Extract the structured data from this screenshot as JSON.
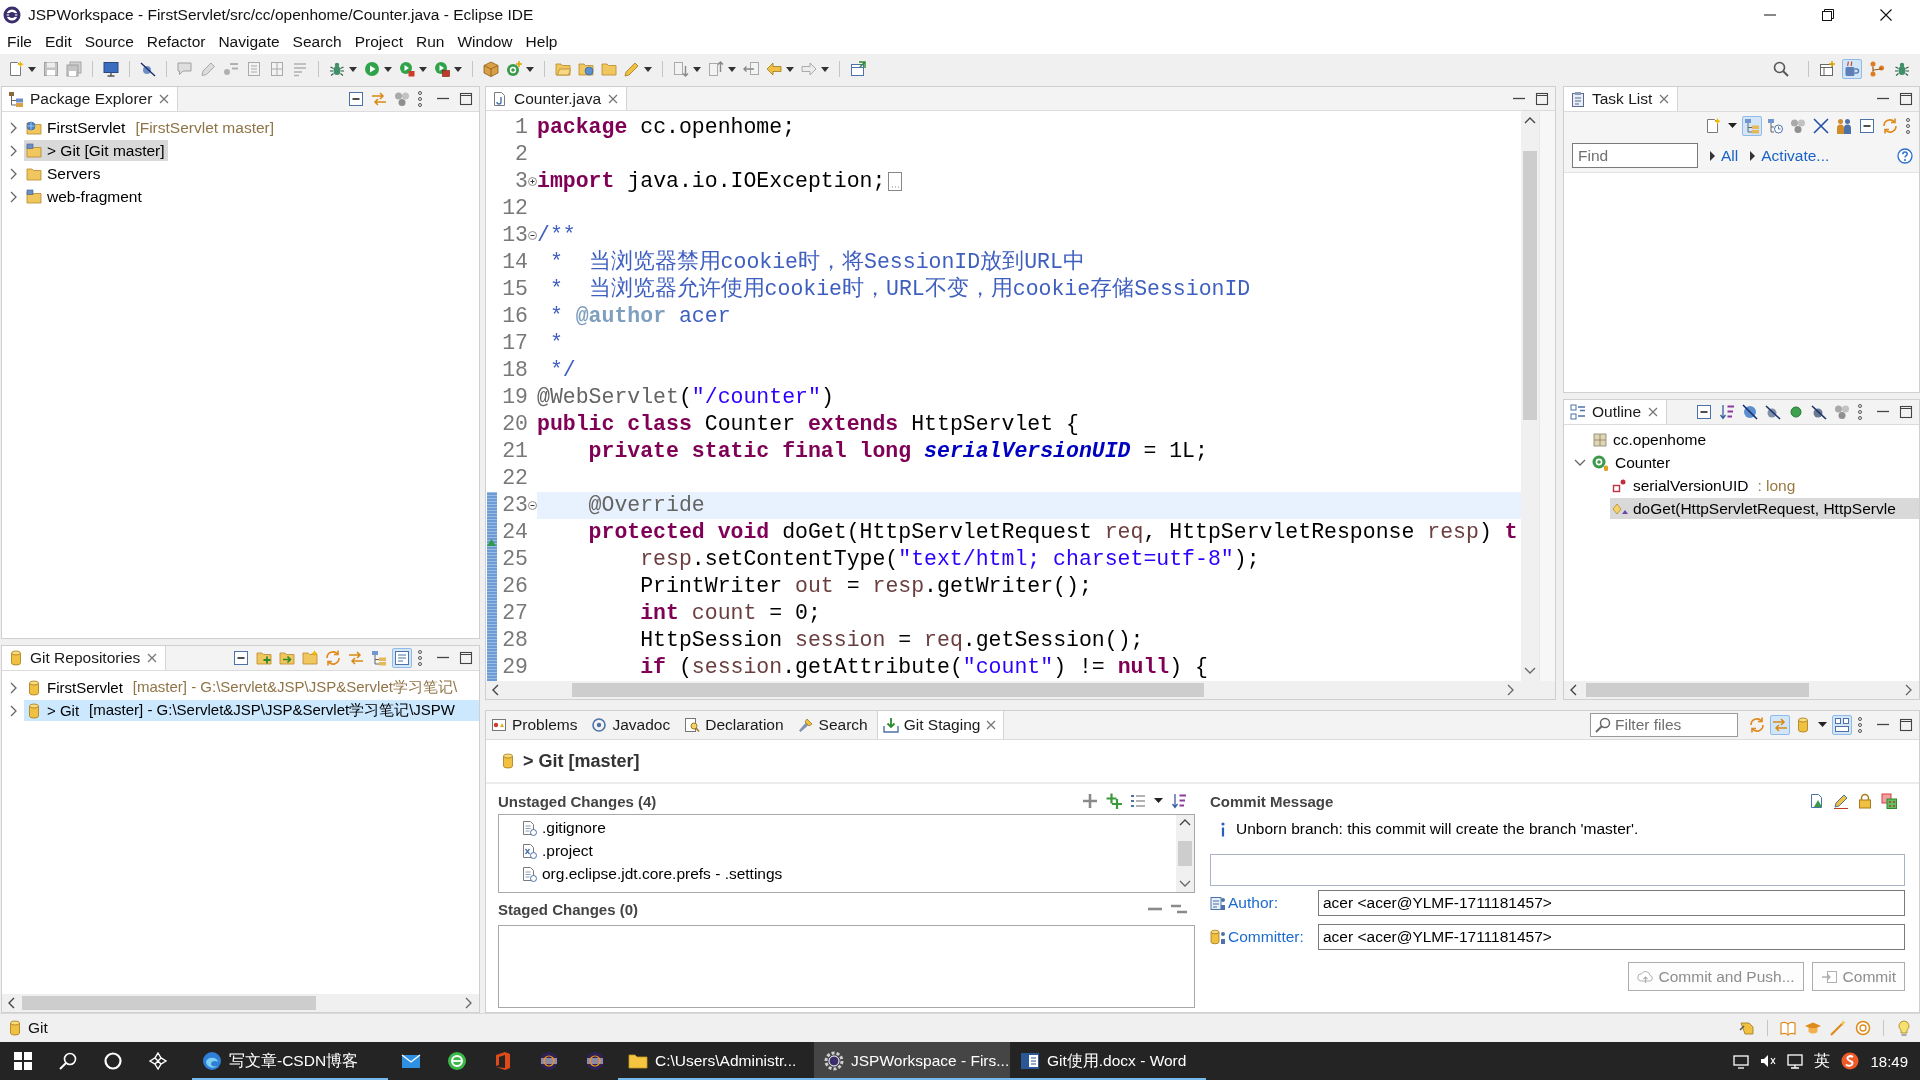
{
  "window": {
    "title": "JSPWorkspace - FirstServlet/src/cc/openhome/Counter.java - Eclipse IDE"
  },
  "menu": [
    "File",
    "Edit",
    "Source",
    "Refactor",
    "Navigate",
    "Search",
    "Project",
    "Run",
    "Window",
    "Help"
  ],
  "perspectives": [
    {
      "kind": "open",
      "selected": false
    },
    {
      "kind": "java",
      "selected": true
    },
    {
      "kind": "git",
      "selected": false
    },
    {
      "kind": "debug",
      "selected": false
    }
  ],
  "package_explorer": {
    "title": "Package Explorer",
    "toolbar": [
      {
        "kind": "collapse-all",
        "selected": false
      },
      {
        "kind": "link-editor",
        "selected": false
      },
      {
        "kind": "filters",
        "selected": false
      },
      {
        "kind": "view-menu",
        "selected": false
      }
    ],
    "items": [
      {
        "kind": "web-project",
        "label": "FirstServlet",
        "decoration": "[FirstServlet master]",
        "expanded": false,
        "selected": false
      },
      {
        "kind": "project",
        "label": "> Git [Git master]",
        "expanded": false,
        "selected": true
      },
      {
        "kind": "folder",
        "label": "Servers",
        "expanded": false,
        "selected": false
      },
      {
        "kind": "project",
        "label": "web-fragment",
        "expanded": false,
        "selected": false
      }
    ]
  },
  "editor": {
    "tab": "Counter.java",
    "lines": [
      {
        "number": "1",
        "changed": false,
        "current": false,
        "tokens": [
          {
            "kind": "keyword",
            "text": "package"
          },
          {
            "kind": "plain",
            "text": " cc.openhome;"
          }
        ]
      },
      {
        "number": "2",
        "changed": false,
        "current": false
      },
      {
        "number": "3",
        "changed": false,
        "current": false,
        "fold": {
          "expanded": false
        },
        "tokens": [
          {
            "kind": "keyword",
            "text": "import"
          },
          {
            "kind": "plain",
            "text": " java.io.IOException;"
          }
        ]
      },
      {
        "number": "12",
        "changed": false,
        "current": false
      },
      {
        "number": "13",
        "changed": false,
        "current": false,
        "fold": {
          "expanded": true
        },
        "tokens": [
          {
            "kind": "javadoc",
            "text": "/**"
          }
        ]
      },
      {
        "number": "14",
        "changed": false,
        "current": false,
        "tokens": [
          {
            "kind": "javadoc",
            "text": " *  当浏览器禁用cookie时，将SessionID放到URL中"
          }
        ]
      },
      {
        "number": "15",
        "changed": false,
        "current": false,
        "tokens": [
          {
            "kind": "javadoc",
            "text": " *  当浏览器允许使用cookie时，URL不变，用cookie存储SessionID"
          }
        ]
      },
      {
        "number": "16",
        "changed": false,
        "current": false,
        "tokens": [
          {
            "kind": "javadoc",
            "text": " * "
          },
          {
            "kind": "javadoc-tag",
            "text": "@author"
          },
          {
            "kind": "javadoc",
            "text": " acer"
          }
        ]
      },
      {
        "number": "17",
        "changed": false,
        "current": false,
        "tokens": [
          {
            "kind": "javadoc",
            "text": " *"
          }
        ]
      },
      {
        "number": "18",
        "changed": false,
        "current": false,
        "tokens": [
          {
            "kind": "javadoc",
            "text": " */"
          }
        ]
      },
      {
        "number": "19",
        "changed": false,
        "current": false,
        "tokens": [
          {
            "kind": "annotation",
            "text": "@WebServlet"
          },
          {
            "kind": "plain",
            "text": "("
          },
          {
            "kind": "string",
            "text": "\"/counter\""
          },
          {
            "kind": "plain",
            "text": ")"
          }
        ]
      },
      {
        "number": "20",
        "changed": false,
        "current": false,
        "tokens": [
          {
            "kind": "keyword",
            "text": "public class"
          },
          {
            "kind": "plain",
            "text": " Counter "
          },
          {
            "kind": "keyword",
            "text": "extends"
          },
          {
            "kind": "plain",
            "text": " HttpServlet {"
          }
        ]
      },
      {
        "number": "21",
        "changed": false,
        "current": false,
        "tokens": [
          {
            "kind": "keyword",
            "text": "    private static final long"
          },
          {
            "kind": "static-field",
            "text": " serialVersionUID"
          },
          {
            "kind": "plain",
            "text": " = 1L;"
          }
        ]
      },
      {
        "number": "22",
        "changed": false,
        "current": false
      },
      {
        "number": "23",
        "changed": true,
        "current": true,
        "fold": {
          "expanded": true
        },
        "tokens": [
          {
            "kind": "annotation",
            "text": "    @Override"
          }
        ]
      },
      {
        "number": "24",
        "changed": true,
        "current": false,
        "marker": {
          "kind": "override"
        },
        "tokens": [
          {
            "kind": "keyword",
            "text": "    protected void"
          },
          {
            "kind": "plain",
            "text": " doGet(HttpServletRequest "
          },
          {
            "kind": "variable",
            "text": "req"
          },
          {
            "kind": "plain",
            "text": ", HttpServletResponse "
          },
          {
            "kind": "variable",
            "text": "resp"
          },
          {
            "kind": "plain",
            "text": ") "
          },
          {
            "kind": "keyword",
            "text": "t"
          }
        ]
      },
      {
        "number": "25",
        "changed": true,
        "current": false,
        "tokens": [
          {
            "kind": "variable",
            "text": "        resp"
          },
          {
            "kind": "plain",
            "text": ".setContentType("
          },
          {
            "kind": "string",
            "text": "\"text/html; charset=utf-8\""
          },
          {
            "kind": "plain",
            "text": ");"
          }
        ]
      },
      {
        "number": "26",
        "changed": true,
        "current": false,
        "tokens": [
          {
            "kind": "plain",
            "text": "        PrintWriter "
          },
          {
            "kind": "variable",
            "text": "out"
          },
          {
            "kind": "plain",
            "text": " = "
          },
          {
            "kind": "variable",
            "text": "resp"
          },
          {
            "kind": "plain",
            "text": ".getWriter();"
          }
        ]
      },
      {
        "number": "27",
        "changed": true,
        "current": false,
        "tokens": [
          {
            "kind": "keyword",
            "text": "        int"
          },
          {
            "kind": "variable",
            "text": " count"
          },
          {
            "kind": "plain",
            "text": " = 0;"
          }
        ]
      },
      {
        "number": "28",
        "changed": true,
        "current": false,
        "tokens": [
          {
            "kind": "plain",
            "text": "        HttpSession "
          },
          {
            "kind": "variable",
            "text": "session"
          },
          {
            "kind": "plain",
            "text": " = "
          },
          {
            "kind": "variable",
            "text": "req"
          },
          {
            "kind": "plain",
            "text": ".getSession();"
          }
        ]
      },
      {
        "number": "29",
        "changed": true,
        "current": false,
        "tokens": [
          {
            "kind": "keyword",
            "text": "        if"
          },
          {
            "kind": "plain",
            "text": " ("
          },
          {
            "kind": "variable",
            "text": "session"
          },
          {
            "kind": "plain",
            "text": ".getAttribute("
          },
          {
            "kind": "string",
            "text": "\"count\""
          },
          {
            "kind": "plain",
            "text": ") != "
          },
          {
            "kind": "keyword",
            "text": "null"
          },
          {
            "kind": "plain",
            "text": ") {"
          }
        ]
      }
    ]
  },
  "task_list": {
    "title": "Task List",
    "toolbar": [
      {
        "kind": "new-task",
        "selected": false
      },
      {
        "kind": "menu-caret",
        "selected": false
      },
      {
        "kind": "categorized",
        "selected": true
      },
      {
        "kind": "scheduled",
        "selected": false
      },
      {
        "kind": "filters",
        "selected": false
      },
      {
        "kind": "hide-completed",
        "selected": false
      },
      {
        "kind": "people",
        "selected": false
      },
      {
        "kind": "collapse-all",
        "selected": false
      },
      {
        "kind": "synchronize",
        "selected": false
      },
      {
        "kind": "view-menu",
        "selected": false
      }
    ],
    "find": {
      "placeholder": "Find"
    },
    "links": [
      "All",
      "Activate..."
    ]
  },
  "outline": {
    "title": "Outline",
    "toolbar": [
      {
        "kind": "collapse-all",
        "selected": false
      },
      {
        "kind": "sort",
        "selected": false
      },
      {
        "kind": "hide-fields",
        "selected": false
      },
      {
        "kind": "hide-static",
        "selected": false
      },
      {
        "kind": "hide-nonpublic",
        "selected": false
      },
      {
        "kind": "hide-local",
        "selected": false
      },
      {
        "kind": "filters",
        "selected": false
      },
      {
        "kind": "view-menu",
        "selected": false
      }
    ],
    "items": [
      {
        "kind": "package",
        "label": "cc.openhome",
        "selected": false
      },
      {
        "kind": "class",
        "label": "Counter",
        "expanded": true,
        "selected": false,
        "children": [
          {
            "kind": "field",
            "label": "serialVersionUID",
            "type": ": long",
            "selected": false
          },
          {
            "kind": "method",
            "label": "doGet(HttpServletRequest, HttpServle",
            "selected": true
          }
        ]
      }
    ]
  },
  "git_repositories": {
    "title": "Git Repositories",
    "toolbar": [
      {
        "kind": "collapse-all",
        "selected": false
      },
      {
        "kind": "add-repo",
        "selected": false
      },
      {
        "kind": "clone",
        "selected": false
      },
      {
        "kind": "create-repo",
        "selected": false
      },
      {
        "kind": "synchronize",
        "selected": false
      },
      {
        "kind": "link-editor",
        "selected": false
      },
      {
        "kind": "categorized",
        "selected": false
      },
      {
        "kind": "link-selection",
        "selected": true
      },
      {
        "kind": "view-menu",
        "selected": false
      }
    ],
    "items": [
      {
        "kind": "repository",
        "label": "FirstServlet",
        "decoration": "[master] - G:\\Servlet&JSP\\JSP&Servlet学习笔记\\",
        "expanded": false,
        "selected": false
      },
      {
        "kind": "repository",
        "label": "> Git",
        "decoration": "[master] - G:\\Servlet&JSP\\JSP&Servlet学习笔记\\JSPW",
        "expanded": false,
        "selected": true
      }
    ]
  },
  "bottom_tabs": [
    {
      "kind": "problems",
      "label": "Problems",
      "selected": false
    },
    {
      "kind": "javadoc",
      "label": "Javadoc",
      "selected": false
    },
    {
      "kind": "declaration",
      "label": "Declaration",
      "selected": false
    },
    {
      "kind": "search",
      "label": "Search",
      "selected": false
    },
    {
      "kind": "staging",
      "label": "Git Staging",
      "selected": true
    }
  ],
  "git_staging": {
    "filter": {
      "placeholder": "Filter files"
    },
    "toolbar": [
      {
        "kind": "synchronize",
        "selected": false
      },
      {
        "kind": "link-editor",
        "selected": true
      },
      {
        "kind": "repository",
        "selected": false
      },
      {
        "kind": "menu-caret",
        "selected": false
      },
      {
        "kind": "presentation",
        "selected": true
      },
      {
        "kind": "view-menu",
        "selected": false
      }
    ],
    "repository": "> Git [master]",
    "unstaged": {
      "title": "Unstaged Changes (4)",
      "toolbar": [
        {
          "kind": "stage",
          "selected": false
        },
        {
          "kind": "stage-all",
          "selected": false
        },
        {
          "kind": "list-presentation",
          "selected": false
        },
        {
          "kind": "menu-caret",
          "selected": false
        },
        {
          "kind": "sort",
          "selected": false
        }
      ],
      "files": [
        {
          "kind": "text",
          "label": ".gitignore"
        },
        {
          "kind": "xml",
          "label": ".project"
        },
        {
          "kind": "text",
          "label": "org.eclipse.jdt.core.prefs - .settings"
        }
      ]
    },
    "staged": {
      "title": "Staged Changes (0)",
      "toolbar": [
        {
          "kind": "unstage",
          "selected": false
        },
        {
          "kind": "unstage-all",
          "selected": false
        }
      ]
    },
    "commit": {
      "title": "Commit Message",
      "toolbar": [
        {
          "kind": "amend",
          "selected": false
        },
        {
          "kind": "sign-off",
          "selected": false
        },
        {
          "kind": "lock",
          "selected": false
        },
        {
          "kind": "gerrit",
          "selected": false
        }
      ],
      "info": "Unborn branch: this commit will create the branch 'master'.",
      "author": {
        "label": "Author:",
        "value": "acer <acer@YLMF-1711181457>"
      },
      "committer": {
        "label": "Committer:",
        "value": "acer <acer@YLMF-1711181457>"
      },
      "buttons": [
        {
          "kind": "commit-push",
          "label": "Commit and Push...",
          "disabled": true
        },
        {
          "kind": "commit",
          "label": "Commit",
          "disabled": true
        }
      ]
    }
  },
  "status_bar": {
    "text": "Git"
  },
  "taskbar": {
    "items": [
      {
        "kind": "browser",
        "label": "写文章-CSDN博客",
        "running": true,
        "selected": false
      },
      {
        "kind": "mail",
        "running": false,
        "selected": false
      },
      {
        "kind": "globe",
        "running": false,
        "selected": false
      },
      {
        "kind": "office",
        "running": false,
        "selected": false
      },
      {
        "kind": "ide",
        "running": false,
        "selected": false
      },
      {
        "kind": "ide",
        "running": false,
        "selected": false
      },
      {
        "kind": "folder",
        "label": "C:\\Users\\Administr...",
        "running": true,
        "selected": false
      },
      {
        "kind": "ide-gear",
        "label": "JSPWorkspace - Firs...",
        "running": true,
        "selected": true
      },
      {
        "kind": "word",
        "label": "Git使用.docx - Word",
        "running": true,
        "selected": false
      }
    ],
    "tray": {
      "ime": "英",
      "time": "18:49"
    }
  }
}
